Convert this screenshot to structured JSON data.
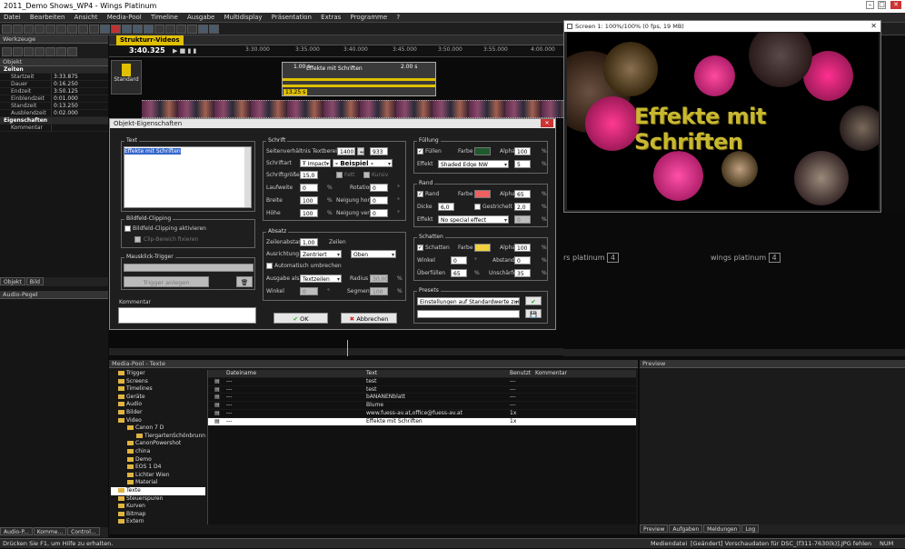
{
  "app_title": "2011_Demo Shows_WP4 - Wings Platinum",
  "menu": [
    "Datei",
    "Bearbeiten",
    "Ansicht",
    "Media-Pool",
    "Timeline",
    "Ausgabe",
    "Multidisplay",
    "Präsentation",
    "Extras",
    "Programme",
    "?"
  ],
  "left": {
    "werkzeuge_title": "Werkzeuge",
    "objekt_title": "Objekt",
    "zeiten_section": "Zeiten",
    "props": [
      {
        "k": "Startzeit",
        "v": "3:33.875"
      },
      {
        "k": "Dauer",
        "v": "0:16.250"
      },
      {
        "k": "Endzeit",
        "v": "3:50.125"
      },
      {
        "k": "Einblendzeit",
        "v": "0:01.000"
      },
      {
        "k": "Standzeit",
        "v": "0:13.250"
      },
      {
        "k": "Ausblendzeit",
        "v": "0:02.000"
      }
    ],
    "eigenschaften_section": "Eigenschaften",
    "kommentar_label": "Kommentar",
    "tab_objekt": "Objekt",
    "tab_bild": "Bild",
    "audio_pegel_title": "Audio-Pegel",
    "bottom_tabs": [
      "Audio-P...",
      "Komme...",
      "Control..."
    ]
  },
  "timeline": {
    "tab": "Strukturr-Videos",
    "time": "3:40.325",
    "ticks": [
      "3:30.000",
      "3:35.000",
      "3:40.000",
      "3:45.000",
      "3:50.000",
      "3:55.000",
      "4:00.000"
    ],
    "track_label": "Standard",
    "clip_fade_in": "1.00 s",
    "clip_title": "Effekte mit Schriften",
    "clip_fade_out": "2.00 s",
    "clip_hold": "13.25 s",
    "wings_logo": "wings platinum",
    "wings_num": "4"
  },
  "screen": {
    "title": "Screen 1: 100%/100% (0 fps, 19 MB)",
    "overlay_text": "Effekte mit Schriften"
  },
  "dialog": {
    "title": "Objekt-Eigenschaften",
    "text_group": "Text",
    "text_value": "Effekte mit Schriften",
    "clip_group": "Bildfeld-Clipping",
    "clip_activate": "Bildfeld-Clipping aktivieren",
    "clip_fix": "Clip-Bereich fixieren",
    "mouse_group": "Mausklick-Trigger",
    "trigger_btn": "Trigger anlegen",
    "kommentar_label": "Kommentar",
    "ok": "OK",
    "cancel": "Abbrechen",
    "schrift": {
      "group": "Schrift",
      "ratio_label": "Seitenverhältnis Textbereich",
      "ratio_w": "1400",
      "ratio_h": "933",
      "font_label": "Schriftart",
      "font_value": "Impact",
      "sample": "- Beispiel -",
      "size_label": "Schriftgröße",
      "size_value": "15,0",
      "fett": "Fett",
      "kursiv": "Kursiv",
      "laufweite_label": "Laufweite",
      "laufweite_value": "0",
      "rotation_label": "Rotation",
      "rotation_value": "0",
      "breite_label": "Breite",
      "breite_value": "100",
      "neig_h_label": "Neigung horiz.",
      "neig_h_value": "0",
      "hoehe_label": "Höhe",
      "hoehe_value": "100",
      "neig_v_label": "Neigung vert.",
      "neig_v_value": "0"
    },
    "absatz": {
      "group": "Absatz",
      "zeilen_label": "Zeilenabstand",
      "zeilen_value": "1,00",
      "zeilen_unit": "Zeilen",
      "ausricht_label": "Ausrichtung",
      "ausricht_value": "Zentriert",
      "vert_value": "Oben",
      "auto_umbr": "Automatisch umbrechen",
      "ausgabe_label": "Ausgabe als",
      "ausgabe_value": "Textzeilen",
      "radius_label": "Radius",
      "radius_value": "30,00",
      "winkel_label": "Winkel",
      "winkel_value": "0",
      "segment_label": "Segment",
      "segment_value": "100"
    },
    "fuellung": {
      "group": "Füllung",
      "fuellen": "Füllen",
      "farbe": "Farbe",
      "alpha": "Alpha",
      "alpha_value": "100",
      "effekt": "Effekt",
      "effekt_value": "Shaded Edge NW",
      "effekt_num": "5",
      "color": "#1d5a2d"
    },
    "rand": {
      "group": "Rand",
      "rand": "Rand",
      "farbe": "Farbe",
      "alpha": "Alpha",
      "alpha_value": "65",
      "dicke": "Dicke",
      "dicke_value": "6,0",
      "gestrichelt": "Gestrichelt",
      "gestr_value": "2,0",
      "effekt": "Effekt",
      "effekt_value": "No special effect",
      "effekt_num": "0",
      "color": "#f06060"
    },
    "schatten": {
      "group": "Schatten",
      "schatten": "Schatten",
      "farbe": "Farbe",
      "alpha": "Alpha",
      "alpha_value": "100",
      "winkel": "Winkel",
      "winkel_value": "0",
      "abstand": "Abstand",
      "abstand_value": "0",
      "ueberfuellen": "Überfüllen",
      "ueberf_value": "65",
      "unschaerfe": "Unschärfe",
      "unsch_value": "35",
      "color": "#f0d040"
    },
    "presets": {
      "group": "Presets",
      "value": "Einstellungen auf Standardwerte zurücks"
    },
    "percent": "%",
    "degree": "°"
  },
  "mediapool": {
    "title": "Media-Pool - Texte",
    "tree": [
      {
        "label": "Trigger",
        "indent": 1
      },
      {
        "label": "Screens",
        "indent": 1
      },
      {
        "label": "Timelines",
        "indent": 1
      },
      {
        "label": "Geräte",
        "indent": 1
      },
      {
        "label": "Audio",
        "indent": 1
      },
      {
        "label": "Bilder",
        "indent": 1
      },
      {
        "label": "Video",
        "indent": 1
      },
      {
        "label": "Canon 7 D",
        "indent": 2
      },
      {
        "label": "TiergartenSchönbrunn",
        "indent": 3
      },
      {
        "label": "CanonPowershot",
        "indent": 2
      },
      {
        "label": "china",
        "indent": 2
      },
      {
        "label": "Demo",
        "indent": 2
      },
      {
        "label": "EOS 1 D4",
        "indent": 2
      },
      {
        "label": "Lichter Wien",
        "indent": 2
      },
      {
        "label": "Material",
        "indent": 2
      },
      {
        "label": "Texte",
        "indent": 1,
        "selected": true
      },
      {
        "label": "Steuerspuren",
        "indent": 1
      },
      {
        "label": "Kurven",
        "indent": 1
      },
      {
        "label": "Bitmap",
        "indent": 1
      },
      {
        "label": "Extern",
        "indent": 1
      }
    ],
    "columns": [
      "Dateiname",
      "Text",
      "Benutzt",
      "Kommentar"
    ],
    "rows": [
      {
        "file": "---",
        "text": "test",
        "used": "---"
      },
      {
        "file": "---",
        "text": "test",
        "used": "---"
      },
      {
        "file": "---",
        "text": "bANANENblatt",
        "used": "---"
      },
      {
        "file": "---",
        "text": "Blume",
        "used": "---"
      },
      {
        "file": "---",
        "text": "www.fuess-av.at,office@fuess-av.at",
        "used": "1x"
      },
      {
        "file": "---",
        "text": "Effekte mit Schriften",
        "used": "1x",
        "selected": true
      }
    ],
    "bottom_tabs": [
      "Preview",
      "Aufgaben",
      "Meldungen",
      "Log"
    ]
  },
  "preview": {
    "title": "Preview"
  },
  "status": {
    "left": "Drücken Sie F1, um Hilfe zu erhalten.",
    "media": "Mediendatei",
    "msg": "[Geändert] Vorschaudaten für DSC_(f311-7630(k)].JPG fehlen",
    "num": "NUM"
  }
}
